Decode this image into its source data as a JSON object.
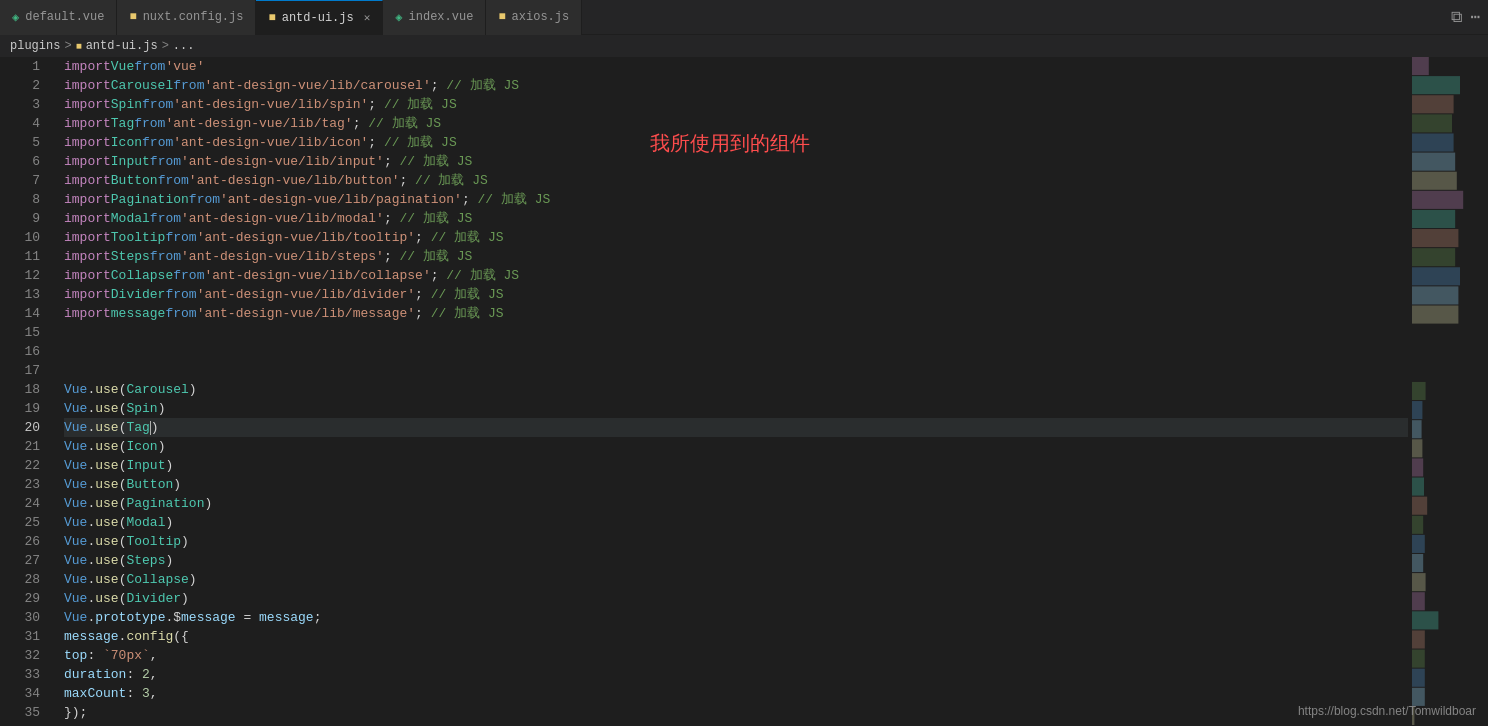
{
  "tabs": [
    {
      "id": "default-vue",
      "label": "default.vue",
      "type": "vue",
      "active": false,
      "dot": false
    },
    {
      "id": "nuxt-config",
      "label": "nuxt.config.js",
      "type": "js",
      "active": false,
      "dot": false
    },
    {
      "id": "antd-ui",
      "label": "antd-ui.js",
      "type": "js",
      "active": true,
      "dot": false,
      "closeable": true
    },
    {
      "id": "index-vue",
      "label": "index.vue",
      "type": "vue",
      "active": false,
      "dot": false
    },
    {
      "id": "axios-js",
      "label": "axios.js",
      "type": "js",
      "active": false,
      "dot": false
    }
  ],
  "breadcrumb": [
    "plugins",
    "antd-ui.js",
    "..."
  ],
  "annotation": "我所使用到的组件",
  "watermark": "https://blog.csdn.net/Tomwildboar",
  "lines": [
    {
      "n": 1,
      "content": "import Vue from 'vue'"
    },
    {
      "n": 2,
      "content": "import Carousel from 'ant-design-vue/lib/carousel'; // 加载 JS"
    },
    {
      "n": 3,
      "content": "import Spin from 'ant-design-vue/lib/spin'; // 加载 JS"
    },
    {
      "n": 4,
      "content": "import Tag from 'ant-design-vue/lib/tag'; // 加载 JS",
      "error": true
    },
    {
      "n": 5,
      "content": "import Icon from 'ant-design-vue/lib/icon'; // 加载 JS"
    },
    {
      "n": 6,
      "content": "import Input from 'ant-design-vue/lib/input'; // 加载 JS"
    },
    {
      "n": 7,
      "content": "import Button from 'ant-design-vue/lib/button'; // 加载 JS"
    },
    {
      "n": 8,
      "content": "import Pagination from 'ant-design-vue/lib/pagination'; // 加载 JS"
    },
    {
      "n": 9,
      "content": "import Modal from 'ant-design-vue/lib/modal'; // 加载 JS"
    },
    {
      "n": 10,
      "content": "import Tooltip from 'ant-design-vue/lib/tooltip'; // 加载 JS"
    },
    {
      "n": 11,
      "content": "import Steps from 'ant-design-vue/lib/steps'; // 加载 JS"
    },
    {
      "n": 12,
      "content": "import Collapse from 'ant-design-vue/lib/collapse'; // 加载 JS"
    },
    {
      "n": 13,
      "content": "import Divider from 'ant-design-vue/lib/divider'; // 加载 JS"
    },
    {
      "n": 14,
      "content": "import message from 'ant-design-vue/lib/message'; // 加载 JS"
    },
    {
      "n": 15,
      "content": ""
    },
    {
      "n": 16,
      "content": ""
    },
    {
      "n": 17,
      "content": ""
    },
    {
      "n": 18,
      "content": "Vue.use(Carousel)"
    },
    {
      "n": 19,
      "content": "Vue.use(Spin)"
    },
    {
      "n": 20,
      "content": "Vue.use(Tag)",
      "active": true
    },
    {
      "n": 21,
      "content": "Vue.use(Icon)"
    },
    {
      "n": 22,
      "content": "Vue.use(Input)"
    },
    {
      "n": 23,
      "content": "Vue.use(Button)"
    },
    {
      "n": 24,
      "content": "Vue.use(Pagination)"
    },
    {
      "n": 25,
      "content": "Vue.use(Modal)"
    },
    {
      "n": 26,
      "content": "Vue.use(Tooltip)"
    },
    {
      "n": 27,
      "content": "Vue.use(Steps)"
    },
    {
      "n": 28,
      "content": "Vue.use(Collapse)"
    },
    {
      "n": 29,
      "content": "Vue.use(Divider)"
    },
    {
      "n": 30,
      "content": "Vue.prototype.$message = message;"
    },
    {
      "n": 31,
      "content": "message.config({"
    },
    {
      "n": 32,
      "content": "    top: `70px`,"
    },
    {
      "n": 33,
      "content": "    duration: 2,"
    },
    {
      "n": 34,
      "content": "    maxCount: 3,"
    },
    {
      "n": 35,
      "content": "});"
    }
  ]
}
